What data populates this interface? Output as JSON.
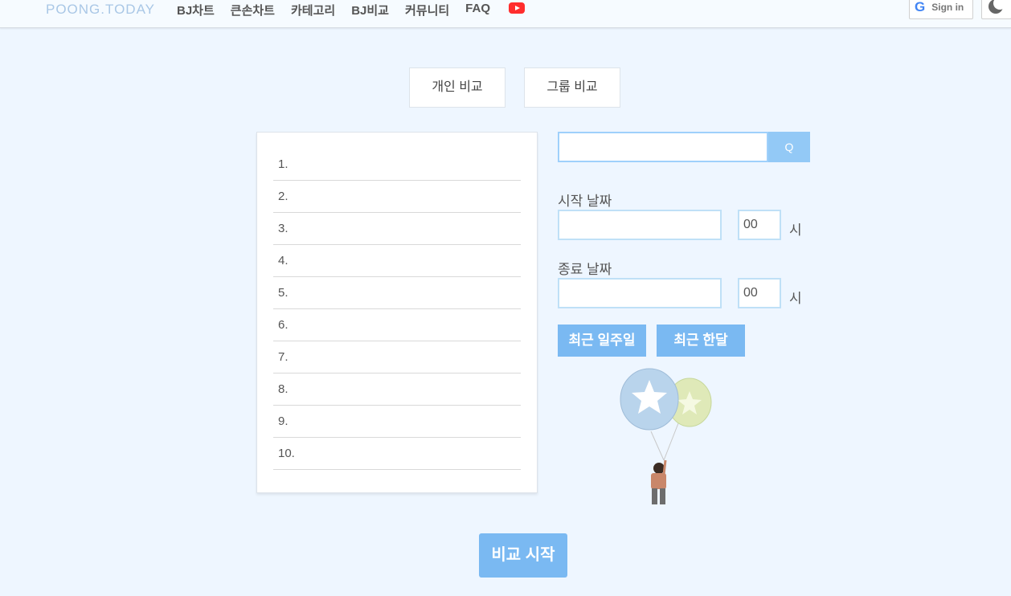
{
  "header": {
    "logo": "POONG.TODAY",
    "nav": [
      "BJ차트",
      "큰손차트",
      "카테고리",
      "BJ비교",
      "커뮤니티",
      "FAQ"
    ],
    "youtube_icon": "youtube-icon",
    "google_signin": "Sign in",
    "dark_mode_icon": "moon-icon"
  },
  "tabs": [
    "개인 비교",
    "그룹 비교"
  ],
  "list": [
    "1.",
    "2.",
    "3.",
    "4.",
    "5.",
    "6.",
    "7.",
    "8.",
    "9.",
    "10."
  ],
  "search": {
    "value": "",
    "button": "Q"
  },
  "start_date": {
    "label": "시작 날짜",
    "value": "",
    "hour": "00",
    "unit": "시"
  },
  "end_date": {
    "label": "종료 날짜",
    "value": "",
    "hour": "00",
    "unit": "시"
  },
  "quick": [
    "최근 일주일",
    "최근 한달"
  ],
  "start_button": "비교 시작",
  "colors": {
    "accent": "#7ab9f2",
    "background": "#eef6ff"
  }
}
